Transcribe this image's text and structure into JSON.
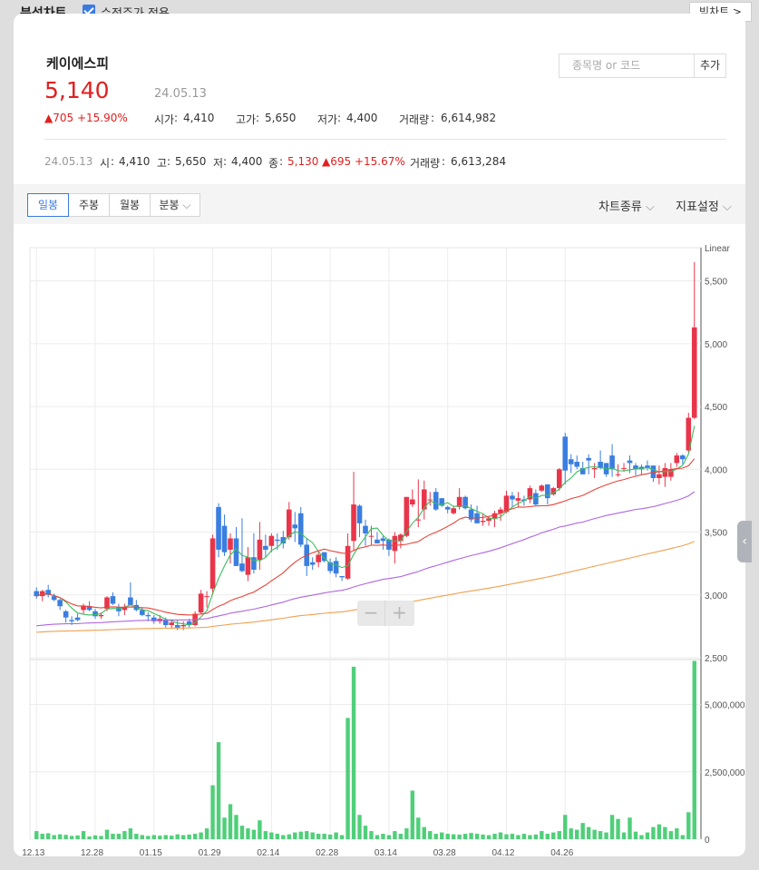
{
  "top": {
    "title": "분석차트",
    "adjusted_label": "수정주가 적용",
    "adjusted_checked": true,
    "big_chart_label": "빅차트 >"
  },
  "stock": {
    "name": "케이에스피",
    "price": "5,140",
    "date": "24.05.13",
    "change": "▲705 +15.90%",
    "open_label": "시가",
    "open": "4,410",
    "high_label": "고가",
    "high": "5,650",
    "low_label": "저가",
    "low": "4,400",
    "volume_label": "거래량",
    "volume": "6,614,982"
  },
  "search": {
    "placeholder": "종목명 or 코드",
    "add_label": "추가"
  },
  "ohlc": {
    "date": "24.05.13",
    "open_label": "시",
    "open": "4,410",
    "high_label": "고",
    "high": "5,650",
    "low_label": "저",
    "low": "4,400",
    "close_label": "종",
    "close": "5,130",
    "change": "▲695 +15.67%",
    "volume_label": "거래량",
    "volume": "6,613,284"
  },
  "toolbar": {
    "tabs": [
      "일봉",
      "주봉",
      "월봉",
      "분봉"
    ],
    "active_tab": "일봉",
    "chart_type_label": "차트종류",
    "indicator_label": "지표설정"
  },
  "colors": {
    "up": "#e8354a",
    "down": "#3a7ee0",
    "volume": "#4fcf79",
    "ma5": "#3dbd5d",
    "ma20": "#e8443a",
    "ma60": "#b066e0",
    "ma120": "#f0a050"
  },
  "chart_data": {
    "type": "candlestick",
    "price_scale": "Linear",
    "price_ticks": [
      "5,500",
      "5,000",
      "4,500",
      "4,000",
      "3,500",
      "3,000",
      "2,500"
    ],
    "price_range": [
      2500,
      5750
    ],
    "volume_ticks": [
      "5,000,000",
      "2,500,000",
      "0"
    ],
    "volume_range": [
      0,
      6600000
    ],
    "date_labels": [
      "12.13",
      "12.28",
      "01.15",
      "01.29",
      "02.14",
      "02.28",
      "03.14",
      "03.28",
      "04.12",
      "04.26"
    ],
    "candles": [
      [
        3030,
        3060,
        2970,
        2990,
        300000
      ],
      [
        2990,
        3040,
        2950,
        3030,
        200000
      ],
      [
        3040,
        3080,
        2980,
        3000,
        220000
      ],
      [
        2990,
        3010,
        2950,
        2960,
        150000
      ],
      [
        2960,
        2970,
        2880,
        2910,
        180000
      ],
      [
        2870,
        2880,
        2780,
        2820,
        160000
      ],
      [
        2800,
        2830,
        2760,
        2790,
        120000
      ],
      [
        2820,
        2850,
        2790,
        2800,
        140000
      ],
      [
        2880,
        2930,
        2850,
        2910,
        300000
      ],
      [
        2910,
        2950,
        2870,
        2880,
        100000
      ],
      [
        2870,
        2890,
        2810,
        2830,
        140000
      ],
      [
        2830,
        2860,
        2810,
        2840,
        120000
      ],
      [
        2890,
        2990,
        2870,
        2980,
        350000
      ],
      [
        2990,
        3020,
        2920,
        2930,
        200000
      ],
      [
        2900,
        2930,
        2830,
        2870,
        200000
      ],
      [
        2880,
        2930,
        2840,
        2900,
        300000
      ],
      [
        2980,
        3100,
        2950,
        2920,
        400000
      ],
      [
        2920,
        2960,
        2870,
        2880,
        200000
      ],
      [
        2880,
        2900,
        2830,
        2840,
        150000
      ],
      [
        2840,
        2860,
        2790,
        2830,
        120000
      ],
      [
        2820,
        2840,
        2770,
        2790,
        150000
      ],
      [
        2790,
        2840,
        2770,
        2810,
        130000
      ],
      [
        2800,
        2820,
        2740,
        2760,
        150000
      ],
      [
        2760,
        2790,
        2730,
        2780,
        130000
      ],
      [
        2760,
        2800,
        2720,
        2740,
        180000
      ],
      [
        2750,
        2790,
        2720,
        2760,
        150000
      ],
      [
        2790,
        2810,
        2740,
        2760,
        170000
      ],
      [
        2760,
        2870,
        2750,
        2850,
        200000
      ],
      [
        2860,
        3040,
        2850,
        3010,
        250000
      ],
      [
        2990,
        3030,
        2900,
        2990,
        400000
      ],
      [
        3050,
        3480,
        3000,
        3450,
        2000000
      ],
      [
        3700,
        3730,
        3300,
        3360,
        3600000
      ],
      [
        3550,
        3640,
        3310,
        3340,
        800000
      ],
      [
        3360,
        3490,
        3250,
        3450,
        1300000
      ],
      [
        3450,
        3540,
        3230,
        3230,
        900000
      ],
      [
        3250,
        3610,
        3180,
        3190,
        500000
      ],
      [
        3160,
        3380,
        3110,
        3300,
        400000
      ],
      [
        3300,
        3490,
        3170,
        3200,
        350000
      ],
      [
        3280,
        3580,
        3200,
        3440,
        700000
      ],
      [
        3390,
        3480,
        3300,
        3360,
        300000
      ],
      [
        3390,
        3490,
        3340,
        3470,
        250000
      ],
      [
        3440,
        3490,
        3360,
        3430,
        200000
      ],
      [
        3460,
        3510,
        3370,
        3410,
        150000
      ],
      [
        3460,
        3740,
        3440,
        3680,
        180000
      ],
      [
        3560,
        3660,
        3420,
        3530,
        250000
      ],
      [
        3650,
        3700,
        3380,
        3400,
        280000
      ],
      [
        3400,
        3450,
        3150,
        3230,
        300000
      ],
      [
        3260,
        3300,
        3200,
        3240,
        250000
      ],
      [
        3260,
        3340,
        3220,
        3320,
        200000
      ],
      [
        3340,
        3340,
        3260,
        3270,
        200000
      ],
      [
        3260,
        3290,
        3170,
        3190,
        170000
      ],
      [
        3270,
        3300,
        3140,
        3170,
        250000
      ],
      [
        3150,
        3140,
        3110,
        3140,
        150000
      ],
      [
        3130,
        3490,
        3120,
        3390,
        4500000
      ],
      [
        3430,
        3980,
        3350,
        3720,
        6400000
      ],
      [
        3710,
        3720,
        3460,
        3570,
        900000
      ],
      [
        3550,
        3600,
        3390,
        3490,
        500000
      ],
      [
        3470,
        3550,
        3400,
        3470,
        300000
      ],
      [
        3440,
        3500,
        3410,
        3410,
        150000
      ],
      [
        3450,
        3470,
        3360,
        3430,
        200000
      ],
      [
        3440,
        3450,
        3310,
        3360,
        150000
      ],
      [
        3350,
        3500,
        3250,
        3470,
        300000
      ],
      [
        3430,
        3490,
        3370,
        3480,
        200000
      ],
      [
        3470,
        3780,
        3460,
        3780,
        400000
      ],
      [
        3720,
        3840,
        3700,
        3760,
        1800000
      ],
      [
        3600,
        3920,
        3540,
        3600,
        800000
      ],
      [
        3680,
        3910,
        3600,
        3840,
        450000
      ],
      [
        3760,
        3820,
        3710,
        3760,
        300000
      ],
      [
        3820,
        3850,
        3670,
        3680,
        200000
      ],
      [
        3770,
        3770,
        3700,
        3710,
        250000
      ],
      [
        3700,
        3710,
        3650,
        3680,
        200000
      ],
      [
        3650,
        3710,
        3640,
        3690,
        180000
      ],
      [
        3700,
        3850,
        3680,
        3780,
        170000
      ],
      [
        3780,
        3790,
        3680,
        3690,
        200000
      ],
      [
        3680,
        3720,
        3580,
        3600,
        230000
      ],
      [
        3650,
        3710,
        3570,
        3570,
        200000
      ],
      [
        3580,
        3640,
        3550,
        3590,
        170000
      ],
      [
        3590,
        3620,
        3550,
        3610,
        150000
      ],
      [
        3610,
        3670,
        3540,
        3650,
        200000
      ],
      [
        3650,
        3700,
        3590,
        3680,
        250000
      ],
      [
        3660,
        3830,
        3650,
        3790,
        180000
      ],
      [
        3790,
        3820,
        3700,
        3760,
        200000
      ],
      [
        3750,
        3820,
        3700,
        3770,
        150000
      ],
      [
        3760,
        3790,
        3710,
        3750,
        200000
      ],
      [
        3760,
        3870,
        3730,
        3850,
        150000
      ],
      [
        3810,
        3840,
        3710,
        3720,
        170000
      ],
      [
        3830,
        3880,
        3820,
        3870,
        300000
      ],
      [
        3880,
        3880,
        3720,
        3770,
        200000
      ],
      [
        3800,
        3860,
        3790,
        3850,
        250000
      ],
      [
        3850,
        4010,
        3830,
        4000,
        300000
      ],
      [
        4260,
        4290,
        3880,
        3990,
        900000
      ],
      [
        4080,
        4120,
        3970,
        4040,
        400000
      ],
      [
        4060,
        4110,
        4000,
        4020,
        350000
      ],
      [
        4010,
        4060,
        3960,
        3960,
        600000
      ],
      [
        4090,
        4120,
        3960,
        4070,
        450000
      ],
      [
        4000,
        4050,
        3930,
        4010,
        350000
      ],
      [
        4060,
        4150,
        4000,
        4010,
        300000
      ],
      [
        4050,
        4050,
        3940,
        3960,
        250000
      ],
      [
        4110,
        4200,
        3940,
        4000,
        900000
      ],
      [
        3960,
        4040,
        3940,
        3960,
        750000
      ],
      [
        4010,
        4050,
        3980,
        4010,
        250000
      ],
      [
        4070,
        4110,
        3970,
        4050,
        800000
      ],
      [
        4030,
        4050,
        3950,
        4000,
        280000
      ],
      [
        4020,
        4040,
        3960,
        4000,
        150000
      ],
      [
        4030,
        4070,
        3990,
        4010,
        250000
      ],
      [
        4030,
        4030,
        3900,
        3930,
        450000
      ],
      [
        3930,
        4030,
        3880,
        3960,
        550000
      ],
      [
        3940,
        4050,
        3860,
        4010,
        450000
      ],
      [
        3940,
        4050,
        3910,
        4000,
        300000
      ],
      [
        4050,
        4130,
        4020,
        4110,
        400000
      ],
      [
        4110,
        4120,
        4040,
        4080,
        150000
      ],
      [
        4150,
        4450,
        4130,
        4410,
        1000000
      ],
      [
        4410,
        5650,
        4400,
        5130,
        6614982
      ]
    ],
    "moving_averages": [
      "MA5",
      "MA20",
      "MA60",
      "MA120"
    ]
  }
}
